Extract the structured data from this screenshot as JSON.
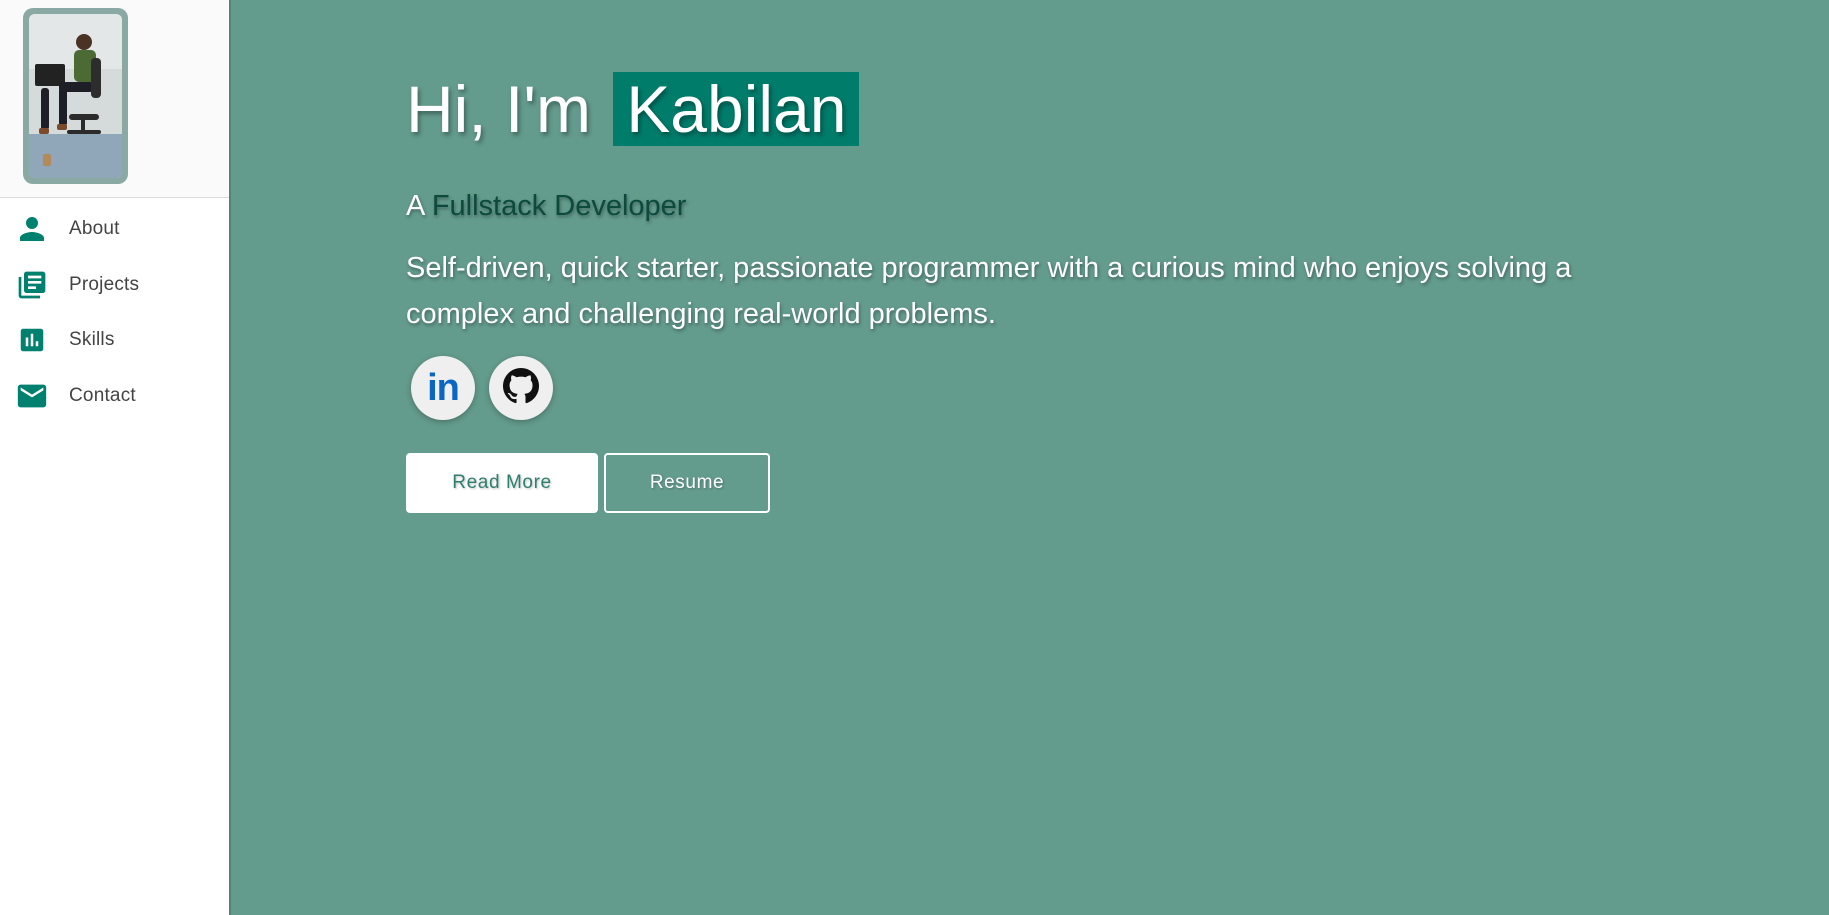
{
  "sidebar": {
    "avatar_alt": "Profile photo",
    "nav": [
      {
        "label": "About",
        "icon": "person-icon"
      },
      {
        "label": "Projects",
        "icon": "library-books-icon"
      },
      {
        "label": "Skills",
        "icon": "bar-chart-icon"
      },
      {
        "label": "Contact",
        "icon": "mail-icon"
      }
    ]
  },
  "hero": {
    "greeting": "Hi, I'm",
    "name": "Kabilan",
    "sub_prefix": "A",
    "role": "Fullstack Developer",
    "description": "Self-driven, quick starter, passionate programmer with a curious mind who enjoys solving a complex and challenging real-world problems."
  },
  "social": [
    {
      "name": "LinkedIn",
      "icon": "linkedin-icon",
      "glyph": "in"
    },
    {
      "name": "GitHub",
      "icon": "github-icon"
    }
  ],
  "actions": {
    "read_more": "Read More",
    "resume": "Resume"
  },
  "colors": {
    "accent": "#007c6b",
    "main_bg": "#639b8c",
    "icon": "#00806e",
    "linkedin": "#0a66c2"
  }
}
